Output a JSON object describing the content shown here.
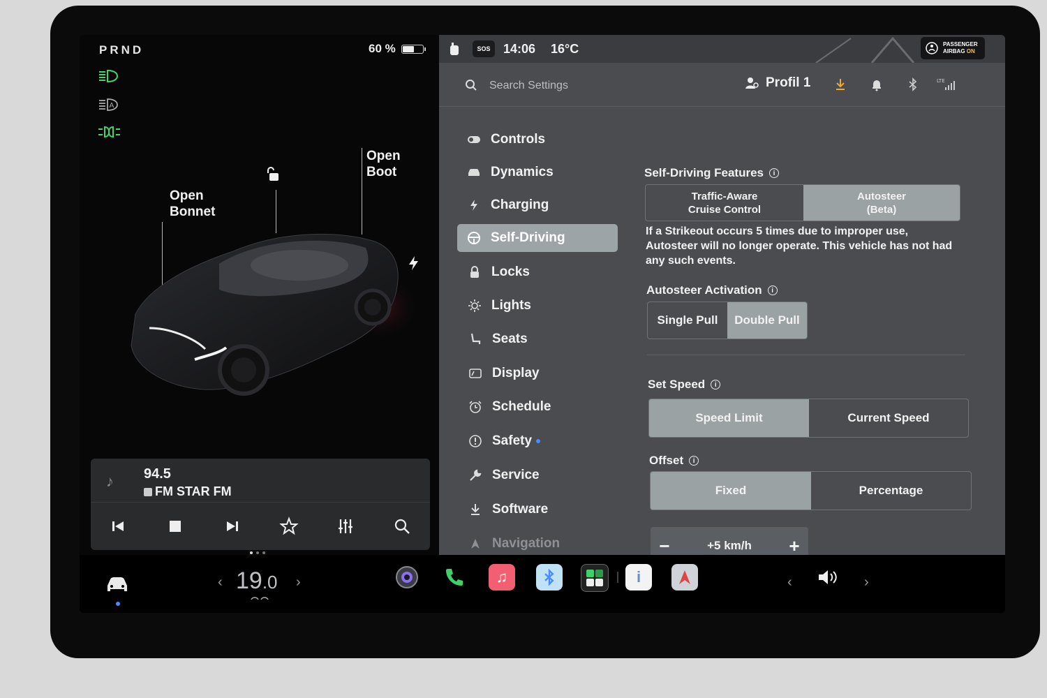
{
  "gear": "PRND",
  "battery": {
    "percent_label": "60 %",
    "level": 0.6
  },
  "car": {
    "open_bonnet": "Open\nBonnet",
    "open_bonnet_l1": "Open",
    "open_bonnet_l2": "Bonnet",
    "open_boot_l1": "Open",
    "open_boot_l2": "Boot"
  },
  "media": {
    "frequency": "94.5",
    "station": "FM STAR FM"
  },
  "status": {
    "sos": "SOS",
    "time": "14:06",
    "temperature": "16°C",
    "airbag_l1": "PASSENGER",
    "airbag_l2": "AIRBAG",
    "airbag_l3": "ON"
  },
  "search": {
    "placeholder": "Search Settings"
  },
  "profile": {
    "name": "Profil 1"
  },
  "nav": [
    {
      "label": "Controls",
      "icon": "toggle-icon"
    },
    {
      "label": "Dynamics",
      "icon": "car-icon"
    },
    {
      "label": "Charging",
      "icon": "bolt-icon"
    },
    {
      "label": "Self-Driving",
      "icon": "steering-wheel-icon",
      "active": true
    },
    {
      "label": "Locks",
      "icon": "lock-icon"
    },
    {
      "label": "Lights",
      "icon": "sun-icon"
    },
    {
      "label": "Seats",
      "icon": "seat-icon"
    },
    {
      "label": "Display",
      "icon": "display-icon"
    },
    {
      "label": "Schedule",
      "icon": "alarm-clock-icon"
    },
    {
      "label": "Safety",
      "icon": "warning-circle-icon",
      "badge": true
    },
    {
      "label": "Service",
      "icon": "wrench-icon"
    },
    {
      "label": "Software",
      "icon": "download-icon"
    },
    {
      "label": "Navigation",
      "icon": "navigation-arrow-icon"
    }
  ],
  "self_driving": {
    "features_title": "Self-Driving Features",
    "feature_options": [
      "Traffic-Aware\nCruise Control",
      "Autosteer\n(Beta)"
    ],
    "feature_opt1_l1": "Traffic-Aware",
    "feature_opt1_l2": "Cruise Control",
    "feature_opt2_l1": "Autosteer",
    "feature_opt2_l2": "(Beta)",
    "features_selected": "Autosteer (Beta)",
    "strikeout_text": "If a Strikeout occurs 5 times due to improper use, Autosteer will no longer operate. This vehicle has not had any such events.",
    "activation_title": "Autosteer Activation",
    "activation_single": "Single Pull",
    "activation_double": "Double Pull",
    "activation_selected": "Double Pull",
    "set_speed_title": "Set Speed",
    "speed_limit": "Speed Limit",
    "current_speed": "Current Speed",
    "set_speed_selected": "Speed Limit",
    "offset_title": "Offset",
    "offset_fixed": "Fixed",
    "offset_percentage": "Percentage",
    "offset_selected": "Fixed",
    "offset_minus": "−",
    "offset_value": "+5 km/h",
    "offset_plus": "+"
  },
  "dock": {
    "temp_main": "19",
    "temp_decimal": ".0"
  },
  "colors": {
    "accent_blue": "#4a8cff",
    "selected_segment": "#9aa2a3",
    "panel": "#4a4c50",
    "lamp_green": "#46d36a"
  }
}
